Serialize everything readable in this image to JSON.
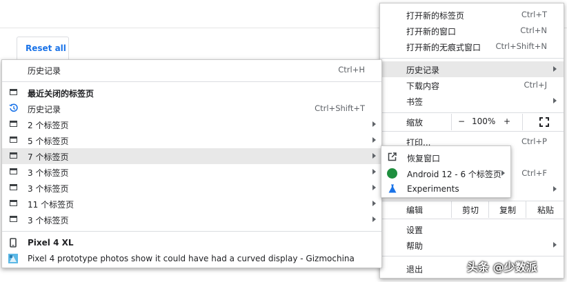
{
  "background": {
    "reset_all": "Reset all"
  },
  "main_menu": {
    "new_tab": {
      "label": "打开新的标签页",
      "shortcut": "Ctrl+T"
    },
    "new_window": {
      "label": "打开新的窗口",
      "shortcut": "Ctrl+N"
    },
    "new_incognito": {
      "label": "打开新的无痕式窗口",
      "shortcut": "Ctrl+Shift+N"
    },
    "history": {
      "label": "历史记录"
    },
    "downloads": {
      "label": "下载内容",
      "shortcut": "Ctrl+J"
    },
    "bookmarks": {
      "label": "书签"
    },
    "zoom": {
      "label": "缩放",
      "minus": "−",
      "value": "100%",
      "plus": "+"
    },
    "print": {
      "label": "打印...",
      "shortcut": "Ctrl+P"
    },
    "find": {
      "shortcut": "Ctrl+F"
    },
    "edit": {
      "label": "编辑",
      "cut": "剪切",
      "copy": "复制",
      "paste": "粘贴"
    },
    "settings": {
      "label": "设置"
    },
    "help": {
      "label": "帮助"
    },
    "exit": {
      "label": "退出"
    }
  },
  "history_menu": {
    "history_header": {
      "label": "历史记录",
      "shortcut": "Ctrl+H"
    },
    "recently_closed": "最近关闭的标签页",
    "history_item": {
      "label": "历史记录",
      "shortcut": "Ctrl+Shift+T"
    },
    "tab_groups": [
      "2 个标签页",
      "5 个标签页",
      "7 个标签页",
      "3 个标签页",
      "3 个标签页",
      "11 个标签页",
      "3 个标签页"
    ],
    "device": "Pixel 4 XL",
    "device_tab": "Pixel 4 prototype photos show it could have had a curved display - Gizmochina"
  },
  "window_menu": {
    "restore": "恢复窗口",
    "android_group": "Android 12 - 6 个标签页",
    "experiments": "Experiments",
    "android_color": "#1e8e3e"
  },
  "watermark": "头条 @少数派"
}
